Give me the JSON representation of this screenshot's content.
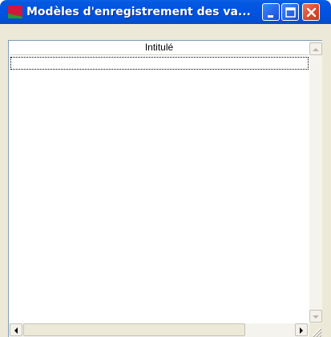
{
  "window": {
    "title": "Modèles d'enregistrement des va...",
    "icon": "app-icon-red-green",
    "controls": {
      "minimize": "minimize-icon",
      "maximize": "maximize-icon",
      "close": "close-icon"
    }
  },
  "list": {
    "columns": [
      "Intitulé"
    ],
    "rows": []
  },
  "colors": {
    "titlebar": "#0054e3",
    "close_button": "#d9492a",
    "frame": "#ece9d8"
  }
}
